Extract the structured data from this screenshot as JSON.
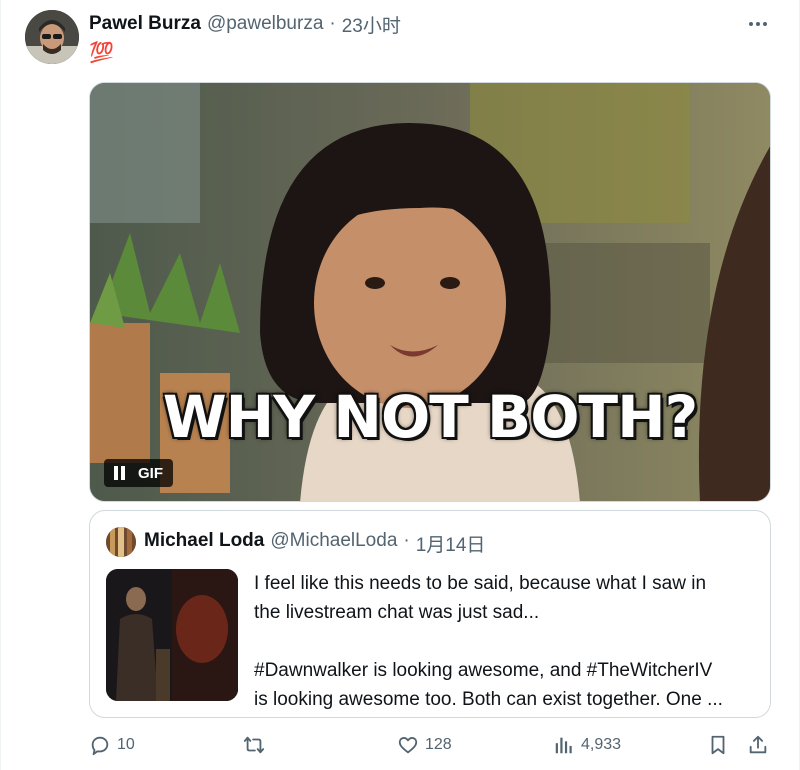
{
  "post": {
    "author_name": "Pawel Burza",
    "handle": "@pawelburza",
    "separator": "·",
    "time": "23小时",
    "text": "💯",
    "more_icon": "more-horizontal-icon"
  },
  "media": {
    "caption": "WHY NOT BOTH?",
    "type_label": "GIF",
    "pause_icon": "pause-icon"
  },
  "quote": {
    "author_name": "Michael Loda",
    "handle": "@MichaelLoda",
    "separator": "·",
    "date": "1月14日",
    "text_lines": [
      "I feel like this needs to be said, because what I saw in",
      "the livestream chat was just sad...",
      "#Dawnwalker is looking awesome, and #TheWitcherIV",
      "is looking awesome too. Both can exist together. One ..."
    ]
  },
  "actions": {
    "reply_count": "10",
    "retweet_count": "",
    "like_count": "128",
    "views_count": "4,933",
    "icons": [
      "reply-icon",
      "retweet-icon",
      "like-icon",
      "views-icon",
      "bookmark-icon",
      "share-icon"
    ]
  },
  "colors": {
    "text_primary": "#0f1419",
    "text_secondary": "#536471",
    "border": "#cfd9de"
  }
}
